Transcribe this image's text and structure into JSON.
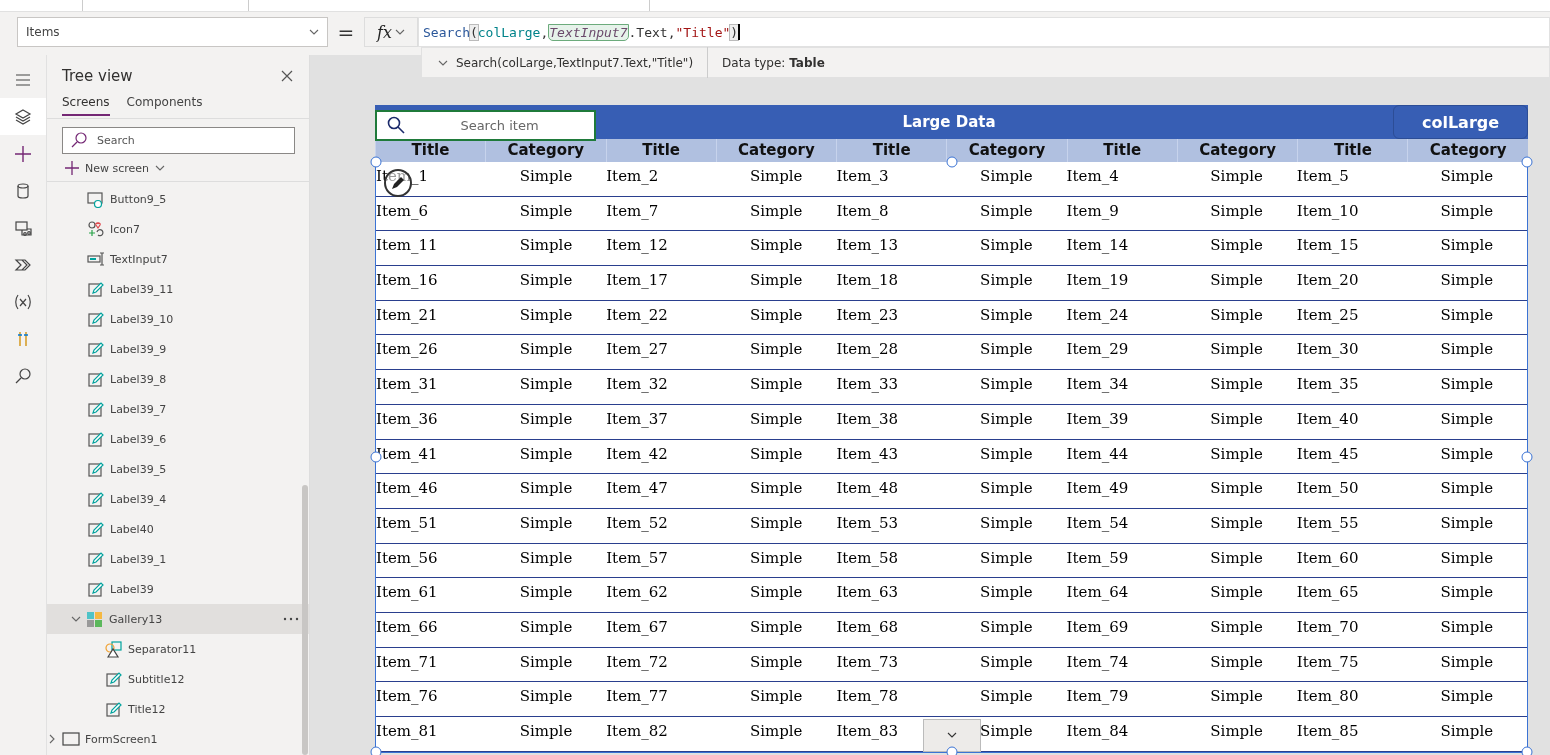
{
  "formula_bar": {
    "property": "Items",
    "equals": "=",
    "fx": "fx",
    "tokens": [
      {
        "text": "Search",
        "kind": "function"
      },
      {
        "text": "(",
        "kind": "paren"
      },
      {
        "text": "colLarge",
        "kind": "name"
      },
      {
        "text": ",",
        "kind": "plain"
      },
      {
        "text": "TextInput7",
        "kind": "control"
      },
      {
        "text": ".Text,",
        "kind": "plain"
      },
      {
        "text": "\"Title\"",
        "kind": "string"
      },
      {
        "text": ")",
        "kind": "paren"
      }
    ],
    "suggestion": "Search(colLarge,TextInput7.Text,\"Title\")",
    "data_type_label": "Data type:",
    "data_type": "Table"
  },
  "rail": [
    {
      "selected": false
    },
    {
      "selected": true
    },
    {
      "selected": false
    },
    {
      "selected": false
    },
    {
      "selected": false
    },
    {
      "selected": false
    },
    {
      "selected": false
    },
    {
      "selected": false
    },
    {
      "selected": false
    }
  ],
  "tree_view": {
    "title": "Tree view",
    "tabs": [
      {
        "label": "Screens",
        "selected": true
      },
      {
        "label": "Components",
        "selected": false
      }
    ],
    "search_placeholder": "Search",
    "new_screen": "New screen",
    "items": [
      {
        "label": "Button9_5",
        "kind": "button",
        "selected": false
      },
      {
        "label": "Icon7",
        "kind": "icon",
        "selected": false
      },
      {
        "label": "TextInput7",
        "kind": "textinput",
        "selected": false
      },
      {
        "label": "Label39_11",
        "kind": "label",
        "selected": false
      },
      {
        "label": "Label39_10",
        "kind": "label",
        "selected": false
      },
      {
        "label": "Label39_9",
        "kind": "label",
        "selected": false
      },
      {
        "label": "Label39_8",
        "kind": "label",
        "selected": false
      },
      {
        "label": "Label39_7",
        "kind": "label",
        "selected": false
      },
      {
        "label": "Label39_6",
        "kind": "label",
        "selected": false
      },
      {
        "label": "Label39_5",
        "kind": "label",
        "selected": false
      },
      {
        "label": "Label39_4",
        "kind": "label",
        "selected": false
      },
      {
        "label": "Label40",
        "kind": "label",
        "selected": false
      },
      {
        "label": "Label39_1",
        "kind": "label",
        "selected": false
      },
      {
        "label": "Label39",
        "kind": "label",
        "selected": false
      },
      {
        "label": "Gallery13",
        "kind": "gallery",
        "selected": true,
        "expanded": true,
        "children": [
          {
            "label": "Separator11",
            "kind": "separator",
            "selected": false
          },
          {
            "label": "Subtitle12",
            "kind": "label",
            "selected": false
          },
          {
            "label": "Title12",
            "kind": "label",
            "selected": false
          }
        ]
      }
    ],
    "screens": [
      {
        "label": "FormScreen1",
        "kind": "screen",
        "expanded": false
      }
    ]
  },
  "app": {
    "search_placeholder": "Search item",
    "title": "Large Data",
    "collection_button": "colLarge",
    "columns": [
      "Title",
      "Category",
      "Title",
      "Category",
      "Title",
      "Category",
      "Title",
      "Category",
      "Title",
      "Category"
    ],
    "rows": [
      [
        "Item_1",
        "Simple",
        "Item_2",
        "Simple",
        "Item_3",
        "Simple",
        "Item_4",
        "Simple",
        "Item_5",
        "Simple"
      ],
      [
        "Item_6",
        "Simple",
        "Item_7",
        "Simple",
        "Item_8",
        "Simple",
        "Item_9",
        "Simple",
        "Item_10",
        "Simple"
      ],
      [
        "Item_11",
        "Simple",
        "Item_12",
        "Simple",
        "Item_13",
        "Simple",
        "Item_14",
        "Simple",
        "Item_15",
        "Simple"
      ],
      [
        "Item_16",
        "Simple",
        "Item_17",
        "Simple",
        "Item_18",
        "Simple",
        "Item_19",
        "Simple",
        "Item_20",
        "Simple"
      ],
      [
        "Item_21",
        "Simple",
        "Item_22",
        "Simple",
        "Item_23",
        "Simple",
        "Item_24",
        "Simple",
        "Item_25",
        "Simple"
      ],
      [
        "Item_26",
        "Simple",
        "Item_27",
        "Simple",
        "Item_28",
        "Simple",
        "Item_29",
        "Simple",
        "Item_30",
        "Simple"
      ],
      [
        "Item_31",
        "Simple",
        "Item_32",
        "Simple",
        "Item_33",
        "Simple",
        "Item_34",
        "Simple",
        "Item_35",
        "Simple"
      ],
      [
        "Item_36",
        "Simple",
        "Item_37",
        "Simple",
        "Item_38",
        "Simple",
        "Item_39",
        "Simple",
        "Item_40",
        "Simple"
      ],
      [
        "Item_41",
        "Simple",
        "Item_42",
        "Simple",
        "Item_43",
        "Simple",
        "Item_44",
        "Simple",
        "Item_45",
        "Simple"
      ],
      [
        "Item_46",
        "Simple",
        "Item_47",
        "Simple",
        "Item_48",
        "Simple",
        "Item_49",
        "Simple",
        "Item_50",
        "Simple"
      ],
      [
        "Item_51",
        "Simple",
        "Item_52",
        "Simple",
        "Item_53",
        "Simple",
        "Item_54",
        "Simple",
        "Item_55",
        "Simple"
      ],
      [
        "Item_56",
        "Simple",
        "Item_57",
        "Simple",
        "Item_58",
        "Simple",
        "Item_59",
        "Simple",
        "Item_60",
        "Simple"
      ],
      [
        "Item_61",
        "Simple",
        "Item_62",
        "Simple",
        "Item_63",
        "Simple",
        "Item_64",
        "Simple",
        "Item_65",
        "Simple"
      ],
      [
        "Item_66",
        "Simple",
        "Item_67",
        "Simple",
        "Item_68",
        "Simple",
        "Item_69",
        "Simple",
        "Item_70",
        "Simple"
      ],
      [
        "Item_71",
        "Simple",
        "Item_72",
        "Simple",
        "Item_73",
        "Simple",
        "Item_74",
        "Simple",
        "Item_75",
        "Simple"
      ],
      [
        "Item_76",
        "Simple",
        "Item_77",
        "Simple",
        "Item_78",
        "Simple",
        "Item_79",
        "Simple",
        "Item_80",
        "Simple"
      ],
      [
        "Item_81",
        "Simple",
        "Item_82",
        "Simple",
        "Item_83",
        "Simple",
        "Item_84",
        "Simple",
        "Item_85",
        "Simple"
      ]
    ]
  }
}
